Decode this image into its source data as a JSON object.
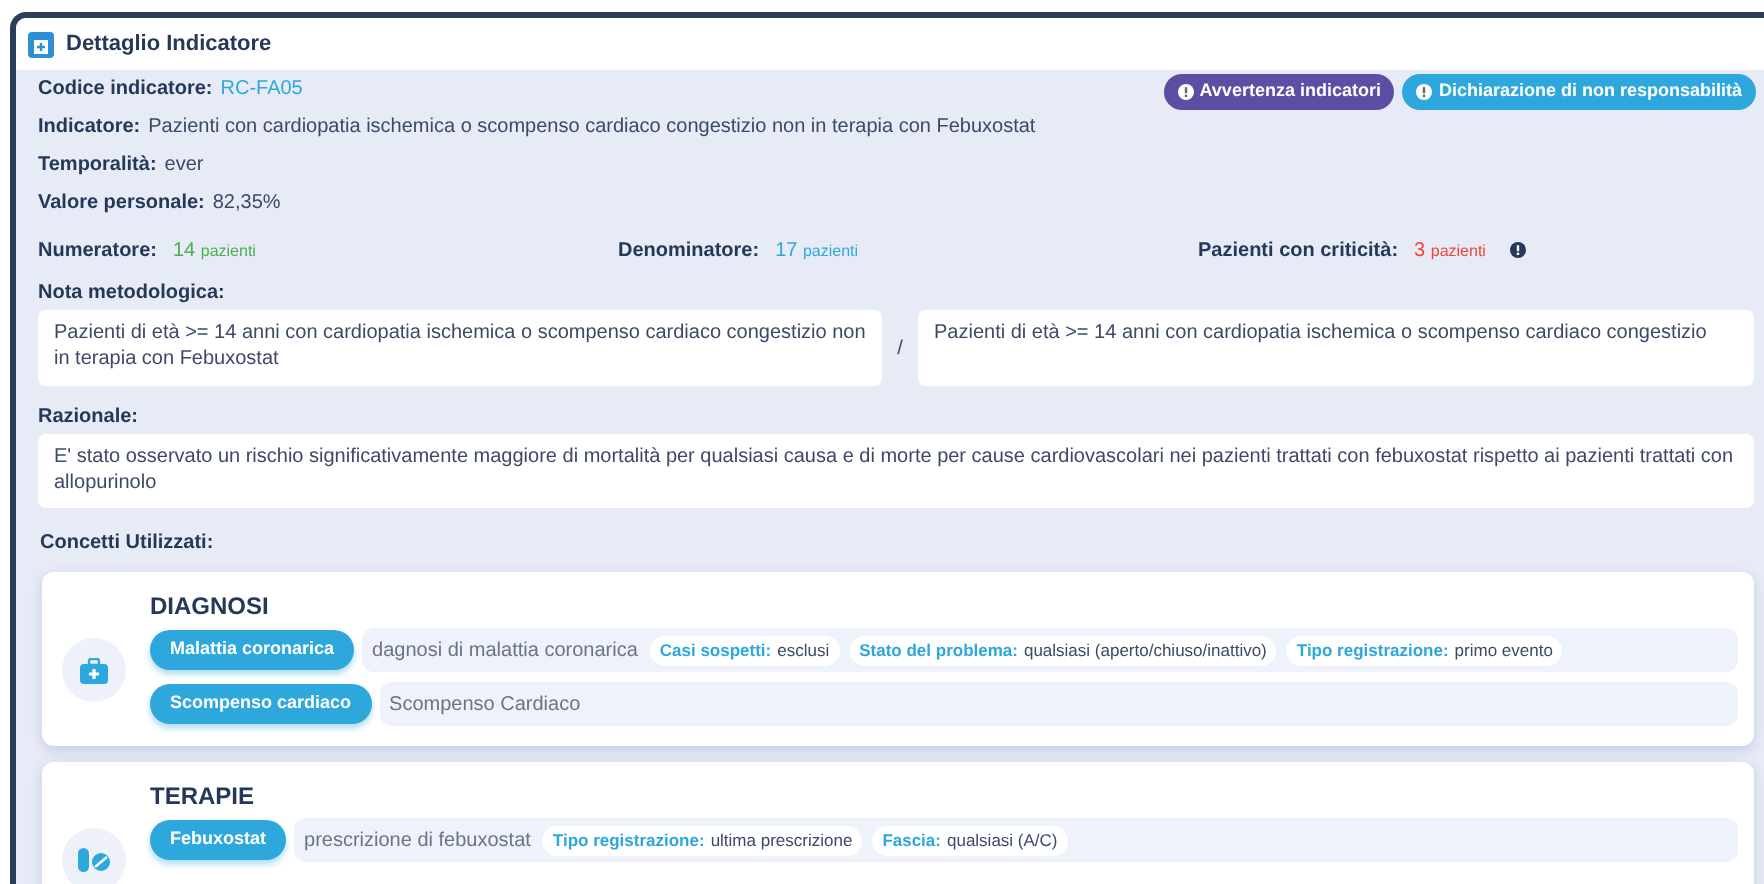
{
  "window": {
    "title": "Dettaglio Indicatore"
  },
  "buttons": [
    {
      "label": "Avvertenza indicatori",
      "kind": "warning"
    },
    {
      "label": "Dichiarazione di non responsabilità",
      "kind": "disclaimer"
    }
  ],
  "fields": [
    {
      "label": "Codice indicatore:",
      "value": "RC-FA05",
      "kind": "link"
    },
    {
      "label": "Indicatore:",
      "value": "Pazienti con cardiopatia ischemica o scompenso cardiaco congestizio non in terapia con Febuxostat",
      "kind": "text"
    },
    {
      "label": "Temporalità:",
      "value": "ever",
      "kind": "text"
    },
    {
      "label": "Valore personale:",
      "value": "82,35%",
      "kind": "text"
    }
  ],
  "counts": [
    {
      "label": "Numeratore:",
      "number": "14",
      "unit": "pazienti",
      "color": "#4caf50",
      "info": false
    },
    {
      "label": "Denominatore:",
      "number": "17",
      "unit": "pazienti",
      "color": "#2ea8dc",
      "info": false
    },
    {
      "label": "Pazienti con criticità:",
      "number": "3",
      "unit": "pazienti",
      "color": "#f44336",
      "info": true
    }
  ],
  "nota_metodologica": {
    "label": "Nota metodologica:",
    "numerator": "Pazienti di età >= 14 anni con cardiopatia ischemica o scompenso cardiaco congestizio non in terapia con Febuxostat",
    "separator": "/",
    "denominator": "Pazienti di età >= 14 anni con cardiopatia ischemica o scompenso cardiaco congestizio"
  },
  "razionale": {
    "label": "Razionale:",
    "text": "E' stato osservato un rischio significativamente maggiore di mortalità per qualsiasi causa e di morte per cause cardiovascolari nei pazienti trattati con febuxostat rispetto ai pazienti trattati con allopurinolo"
  },
  "concetti": {
    "label": "Concetti Utilizzati:",
    "groups": [
      {
        "title": "DIAGNOSI",
        "kind": "diagnosis",
        "items": [
          {
            "name": "Malattia coronarica",
            "description": "dagnosi di malattia coronarica",
            "tags": [
              {
                "key": "Casi sospetti:",
                "value": "esclusi"
              },
              {
                "key": "Stato del problema:",
                "value": "qualsiasi (aperto/chiuso/inattivo)"
              },
              {
                "key": "Tipo registrazione:",
                "value": "primo evento"
              }
            ]
          },
          {
            "name": "Scompenso cardiaco",
            "description": "Scompenso Cardiaco"
          }
        ]
      },
      {
        "title": "TERAPIE",
        "kind": "therapy",
        "items": [
          {
            "name": "Febuxostat",
            "description": "prescrizione di febuxostat",
            "tags": [
              {
                "key": "Tipo registrazione:",
                "value": "ultima prescrizione"
              },
              {
                "key": "Fascia:",
                "value": "qualsiasi (A/C)"
              }
            ]
          }
        ]
      }
    ]
  }
}
